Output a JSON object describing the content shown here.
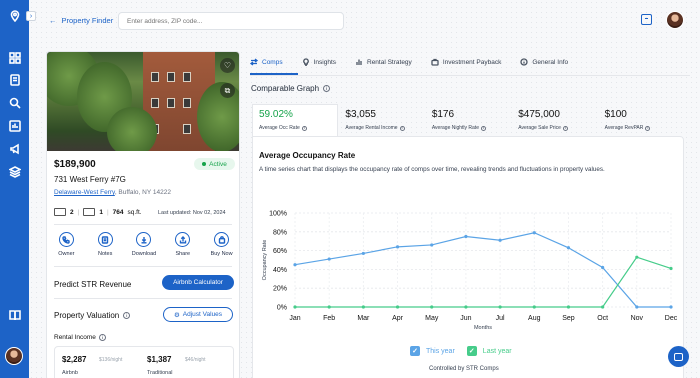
{
  "nav": {
    "back_label": "Property Finder",
    "search_placeholder": "Enter address, ZIP code..."
  },
  "property": {
    "price": "$189,900",
    "status": "Active",
    "address": "731 West Ferry #7G",
    "neighborhood": "Delaware-West Ferry",
    "city_state_zip": ", Buffalo, NY 14222",
    "beds": "2",
    "baths": "1",
    "sqft_value": "764",
    "sqft_unit": " sq.ft.",
    "last_updated": "Last updated: Nov 02, 2024"
  },
  "actions": [
    {
      "label": "Owner",
      "icon": "phone-icon"
    },
    {
      "label": "Notes",
      "icon": "notes-icon"
    },
    {
      "label": "Download",
      "icon": "download-icon"
    },
    {
      "label": "Share",
      "icon": "share-icon"
    },
    {
      "label": "Buy Now",
      "icon": "bag-icon"
    }
  ],
  "predict": {
    "title": "Predict STR Revenue",
    "button": "Airbnb Calculator"
  },
  "valuation": {
    "title": "Property Valuation",
    "adjust_button": "Adjust Values",
    "rental_income_label": "Rental Income",
    "airbnb_value": "$2,287",
    "airbnb_nightly": "$136/night",
    "airbnb_label": "Airbnb",
    "traditional_value": "$1,387",
    "traditional_nightly": "$46/night",
    "traditional_label": "Traditional"
  },
  "tabs": [
    {
      "label": "Comps",
      "icon": "comps-icon"
    },
    {
      "label": "Insights",
      "icon": "bulb-icon"
    },
    {
      "label": "Rental Strategy",
      "icon": "bars-icon"
    },
    {
      "label": "Investment Payback",
      "icon": "briefcase-icon"
    },
    {
      "label": "General Info",
      "icon": "info-icon"
    }
  ],
  "comparable_title": "Comparable Graph",
  "metrics": [
    {
      "value": "59.02%",
      "label": "Average Occ Rate"
    },
    {
      "value": "$3,055",
      "label": "Average Rental Income"
    },
    {
      "value": "$176",
      "label": "Average Nightly Rate"
    },
    {
      "value": "$475,000",
      "label": "Average Sale Price"
    },
    {
      "value": "$100",
      "label": "Average RevPAR"
    }
  ],
  "chart_title": "Average Occupancy Rate",
  "chart_description": "A time series chart that displays the occupancy rate of comps over time, revealing trends and fluctuations in property values.",
  "chart_data": {
    "type": "line",
    "categories": [
      "Jan",
      "Feb",
      "Mar",
      "Apr",
      "May",
      "Jun",
      "Jul",
      "Aug",
      "Sep",
      "Oct",
      "Nov",
      "Dec"
    ],
    "series": [
      {
        "name": "This year",
        "color": "#5ba4e6",
        "values": [
          45,
          51,
          57,
          64,
          66,
          75,
          71,
          79,
          63,
          42,
          0,
          0
        ]
      },
      {
        "name": "Last year",
        "color": "#46cc8a",
        "values": [
          0,
          0,
          0,
          0,
          0,
          0,
          0,
          0,
          0,
          0,
          53,
          41
        ]
      }
    ],
    "yticks": [
      "0%",
      "20%",
      "40%",
      "60%",
      "80%",
      "100%"
    ],
    "ylim": [
      0,
      100
    ],
    "ylabel": "Occupancy Rate",
    "xlabel": "Months",
    "grid": true
  },
  "chart_footer": "Controlled by STR Comps",
  "colors": {
    "brand": "#1d63c7",
    "active_green": "#16a34a"
  }
}
